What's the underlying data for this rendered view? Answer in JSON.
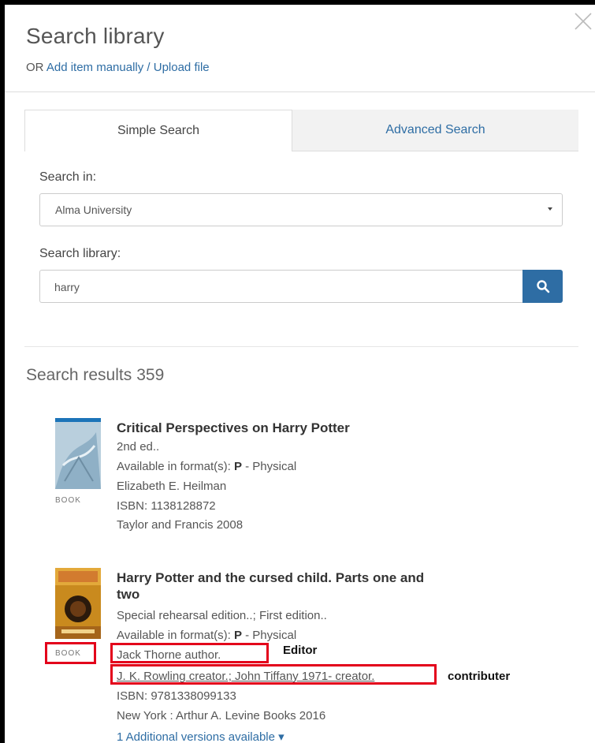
{
  "panel": {
    "title": "Search library",
    "or_text": "OR",
    "add_link": "Add item manually / Upload file"
  },
  "tabs": [
    {
      "label": "Simple Search",
      "active": true
    },
    {
      "label": "Advanced Search",
      "active": false
    }
  ],
  "form": {
    "search_in_label": "Search in:",
    "search_in_value": "Alma University",
    "search_library_label": "Search library:",
    "search_value": "harry",
    "search_button_icon": "search-icon"
  },
  "results": {
    "title": "Search results",
    "count": "359",
    "items": [
      {
        "type": "BOOK",
        "title": "Critical Perspectives on Harry Potter",
        "edition": "2nd ed..",
        "format_prefix": "Available in format(s):",
        "format_code": "P",
        "format_suffix": "- Physical",
        "author": "Elizabeth E. Heilman",
        "isbn": "ISBN: 1138128872",
        "publisher": "Taylor and Francis 2008"
      },
      {
        "type": "BOOK",
        "title_line1": "Harry Potter and the cursed child. Parts one and",
        "title_line2": "two",
        "edition": "Special rehearsal edition..; First edition..",
        "format_prefix": "Available in format(s):",
        "format_code": "P",
        "format_suffix": "- Physical",
        "author": "Jack Thorne author.",
        "contributors": "J. K. Rowling creator.; John Tiffany 1971- creator.",
        "isbn": "ISBN: 9781338099133",
        "publisher": "New York : Arthur A. Levine Books 2016",
        "versions_link": "1 Additional versions available ▾"
      }
    ]
  },
  "annotations": {
    "editor": "Editor",
    "contributor": "contributer"
  },
  "colors": {
    "link": "#2e6da4",
    "highlight": "#e3001b"
  }
}
